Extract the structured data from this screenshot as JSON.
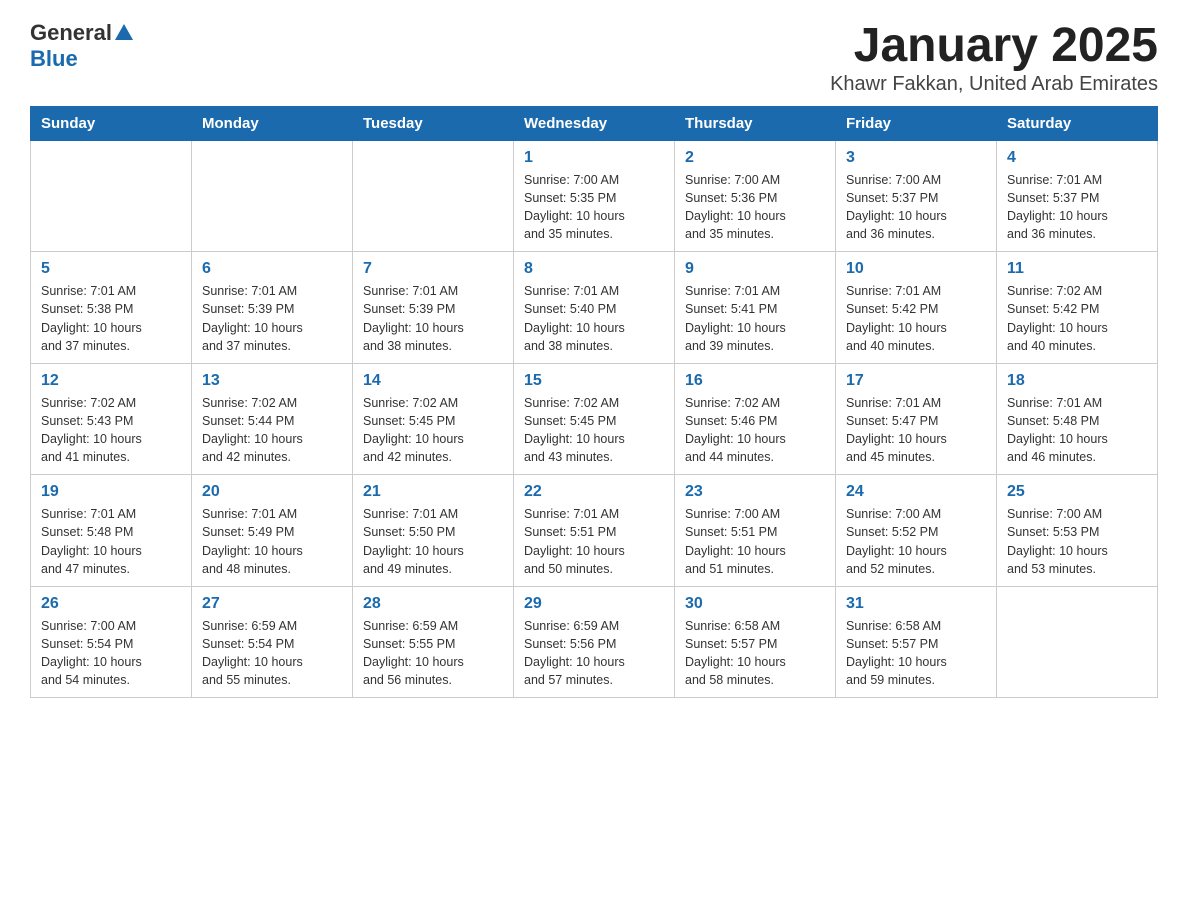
{
  "header": {
    "logo_general": "General",
    "logo_blue": "Blue",
    "title": "January 2025",
    "subtitle": "Khawr Fakkan, United Arab Emirates"
  },
  "days_of_week": [
    "Sunday",
    "Monday",
    "Tuesday",
    "Wednesday",
    "Thursday",
    "Friday",
    "Saturday"
  ],
  "weeks": [
    [
      {
        "day": "",
        "info": ""
      },
      {
        "day": "",
        "info": ""
      },
      {
        "day": "",
        "info": ""
      },
      {
        "day": "1",
        "info": "Sunrise: 7:00 AM\nSunset: 5:35 PM\nDaylight: 10 hours\nand 35 minutes."
      },
      {
        "day": "2",
        "info": "Sunrise: 7:00 AM\nSunset: 5:36 PM\nDaylight: 10 hours\nand 35 minutes."
      },
      {
        "day": "3",
        "info": "Sunrise: 7:00 AM\nSunset: 5:37 PM\nDaylight: 10 hours\nand 36 minutes."
      },
      {
        "day": "4",
        "info": "Sunrise: 7:01 AM\nSunset: 5:37 PM\nDaylight: 10 hours\nand 36 minutes."
      }
    ],
    [
      {
        "day": "5",
        "info": "Sunrise: 7:01 AM\nSunset: 5:38 PM\nDaylight: 10 hours\nand 37 minutes."
      },
      {
        "day": "6",
        "info": "Sunrise: 7:01 AM\nSunset: 5:39 PM\nDaylight: 10 hours\nand 37 minutes."
      },
      {
        "day": "7",
        "info": "Sunrise: 7:01 AM\nSunset: 5:39 PM\nDaylight: 10 hours\nand 38 minutes."
      },
      {
        "day": "8",
        "info": "Sunrise: 7:01 AM\nSunset: 5:40 PM\nDaylight: 10 hours\nand 38 minutes."
      },
      {
        "day": "9",
        "info": "Sunrise: 7:01 AM\nSunset: 5:41 PM\nDaylight: 10 hours\nand 39 minutes."
      },
      {
        "day": "10",
        "info": "Sunrise: 7:01 AM\nSunset: 5:42 PM\nDaylight: 10 hours\nand 40 minutes."
      },
      {
        "day": "11",
        "info": "Sunrise: 7:02 AM\nSunset: 5:42 PM\nDaylight: 10 hours\nand 40 minutes."
      }
    ],
    [
      {
        "day": "12",
        "info": "Sunrise: 7:02 AM\nSunset: 5:43 PM\nDaylight: 10 hours\nand 41 minutes."
      },
      {
        "day": "13",
        "info": "Sunrise: 7:02 AM\nSunset: 5:44 PM\nDaylight: 10 hours\nand 42 minutes."
      },
      {
        "day": "14",
        "info": "Sunrise: 7:02 AM\nSunset: 5:45 PM\nDaylight: 10 hours\nand 42 minutes."
      },
      {
        "day": "15",
        "info": "Sunrise: 7:02 AM\nSunset: 5:45 PM\nDaylight: 10 hours\nand 43 minutes."
      },
      {
        "day": "16",
        "info": "Sunrise: 7:02 AM\nSunset: 5:46 PM\nDaylight: 10 hours\nand 44 minutes."
      },
      {
        "day": "17",
        "info": "Sunrise: 7:01 AM\nSunset: 5:47 PM\nDaylight: 10 hours\nand 45 minutes."
      },
      {
        "day": "18",
        "info": "Sunrise: 7:01 AM\nSunset: 5:48 PM\nDaylight: 10 hours\nand 46 minutes."
      }
    ],
    [
      {
        "day": "19",
        "info": "Sunrise: 7:01 AM\nSunset: 5:48 PM\nDaylight: 10 hours\nand 47 minutes."
      },
      {
        "day": "20",
        "info": "Sunrise: 7:01 AM\nSunset: 5:49 PM\nDaylight: 10 hours\nand 48 minutes."
      },
      {
        "day": "21",
        "info": "Sunrise: 7:01 AM\nSunset: 5:50 PM\nDaylight: 10 hours\nand 49 minutes."
      },
      {
        "day": "22",
        "info": "Sunrise: 7:01 AM\nSunset: 5:51 PM\nDaylight: 10 hours\nand 50 minutes."
      },
      {
        "day": "23",
        "info": "Sunrise: 7:00 AM\nSunset: 5:51 PM\nDaylight: 10 hours\nand 51 minutes."
      },
      {
        "day": "24",
        "info": "Sunrise: 7:00 AM\nSunset: 5:52 PM\nDaylight: 10 hours\nand 52 minutes."
      },
      {
        "day": "25",
        "info": "Sunrise: 7:00 AM\nSunset: 5:53 PM\nDaylight: 10 hours\nand 53 minutes."
      }
    ],
    [
      {
        "day": "26",
        "info": "Sunrise: 7:00 AM\nSunset: 5:54 PM\nDaylight: 10 hours\nand 54 minutes."
      },
      {
        "day": "27",
        "info": "Sunrise: 6:59 AM\nSunset: 5:54 PM\nDaylight: 10 hours\nand 55 minutes."
      },
      {
        "day": "28",
        "info": "Sunrise: 6:59 AM\nSunset: 5:55 PM\nDaylight: 10 hours\nand 56 minutes."
      },
      {
        "day": "29",
        "info": "Sunrise: 6:59 AM\nSunset: 5:56 PM\nDaylight: 10 hours\nand 57 minutes."
      },
      {
        "day": "30",
        "info": "Sunrise: 6:58 AM\nSunset: 5:57 PM\nDaylight: 10 hours\nand 58 minutes."
      },
      {
        "day": "31",
        "info": "Sunrise: 6:58 AM\nSunset: 5:57 PM\nDaylight: 10 hours\nand 59 minutes."
      },
      {
        "day": "",
        "info": ""
      }
    ]
  ]
}
